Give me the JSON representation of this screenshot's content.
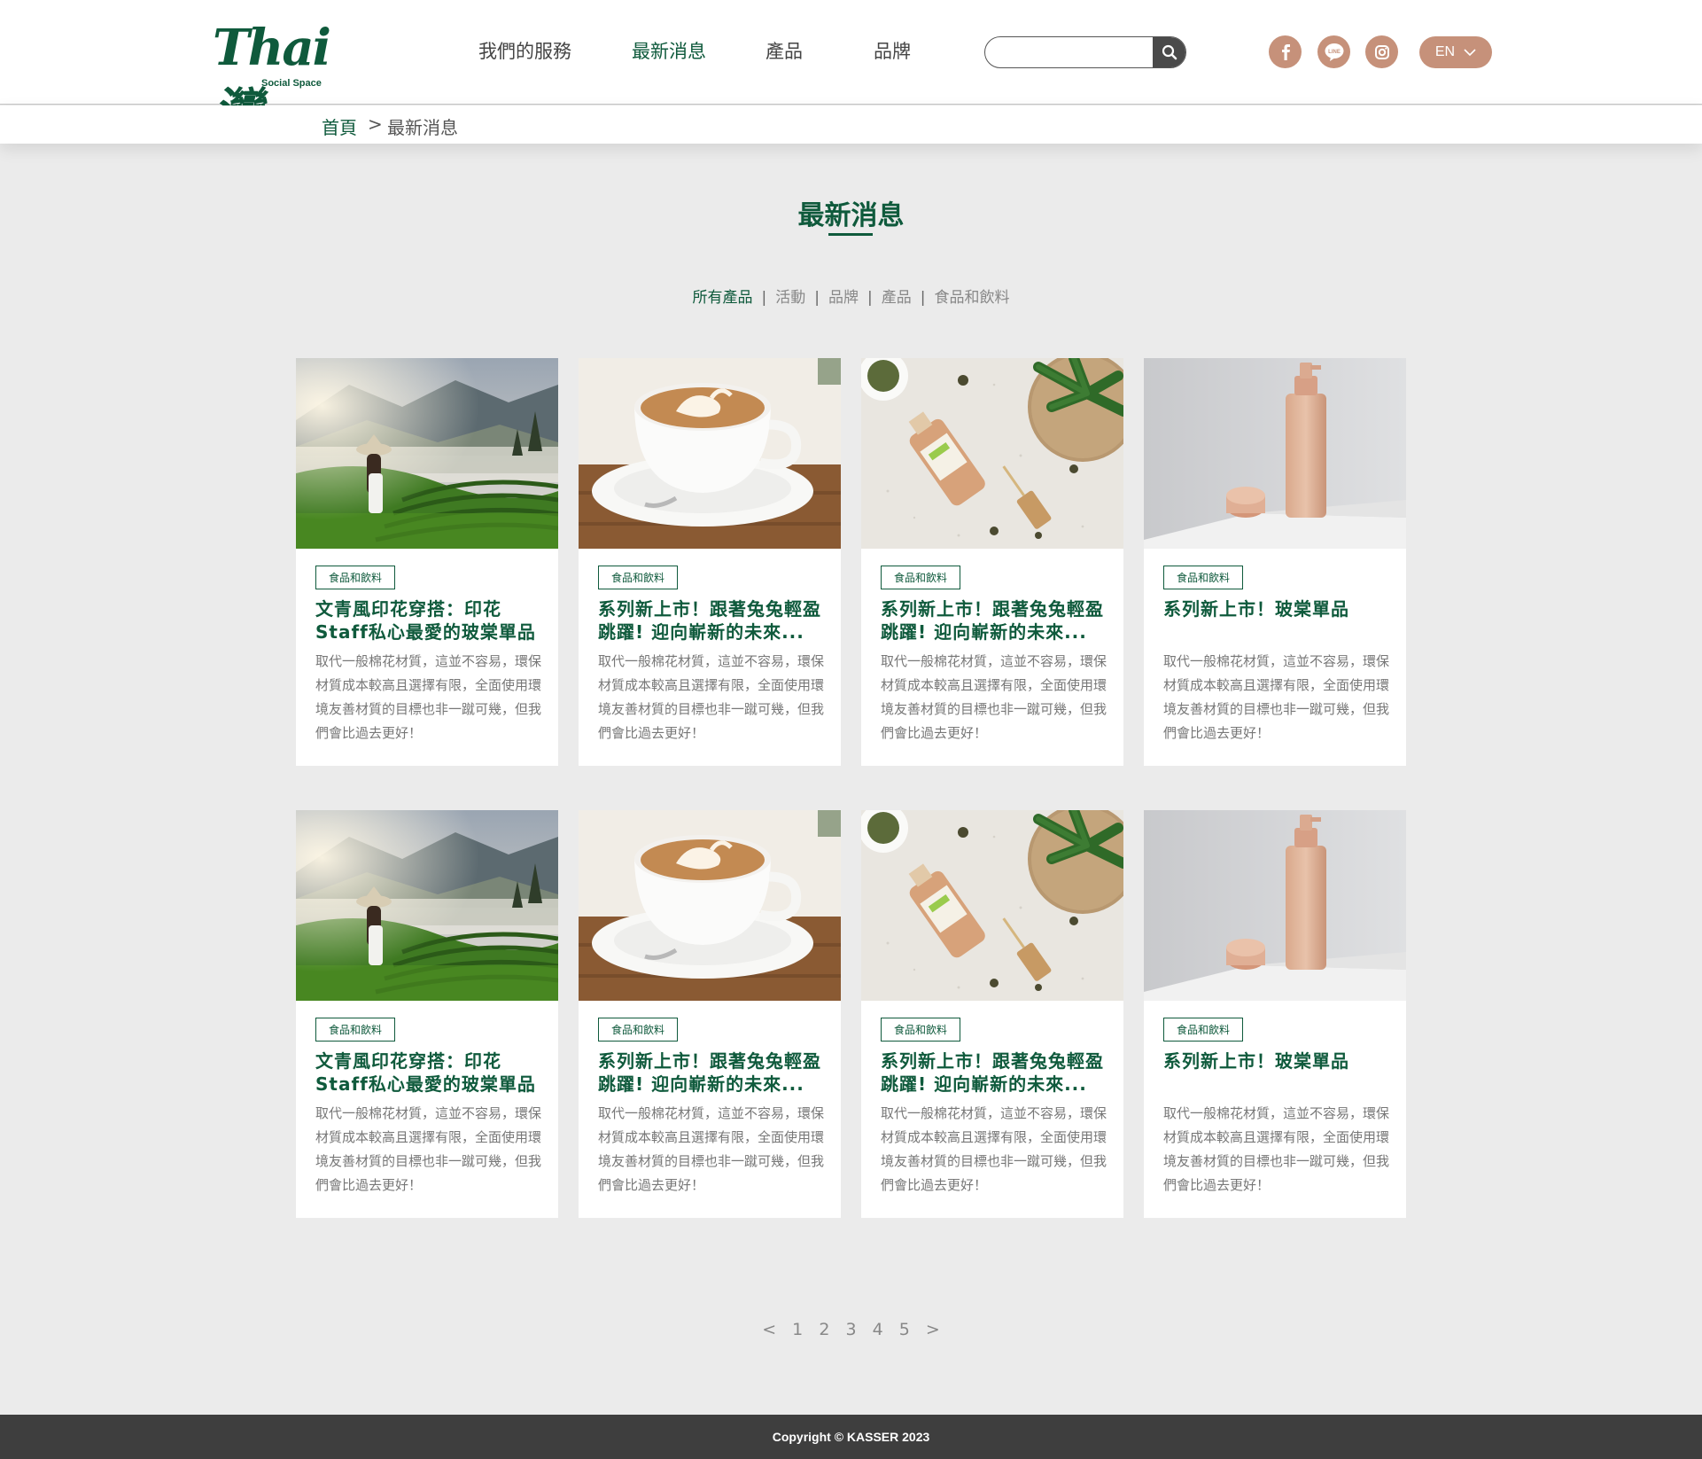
{
  "header": {
    "logo_text": "Thai灣",
    "logo_sub": "Social Space",
    "nav": [
      {
        "label": "我們的服務"
      },
      {
        "label": "最新消息"
      },
      {
        "label": "產品"
      },
      {
        "label": "品牌"
      }
    ],
    "active_nav": "最新消息",
    "search": {
      "placeholder": "",
      "value": ""
    },
    "social": [
      "facebook-icon",
      "line-icon",
      "instagram-icon"
    ],
    "lang": "EN"
  },
  "breadcrumb": {
    "home": "首頁",
    "separator": ">",
    "current": "最新消息"
  },
  "page_title": "最新消息",
  "filters": [
    "所有產品",
    "活動",
    "品牌",
    "產品",
    "食品和飲料"
  ],
  "active_filter": "所有產品",
  "cards": [
    {
      "image": "tea-plantation",
      "tag": "食品和飲料",
      "title": "文青風印花穿搭：印花Staff私心最愛的玻棠單品",
      "desc": "取代一般棉花材質，這並不容易，環保材質成本較高且選擇有限，全面使用環境友善材質的目標也非一蹴可幾，但我們會比過去更好！"
    },
    {
      "image": "latte-cup",
      "tag": "食品和飲料",
      "title": "系列新上市！跟著兔兔輕盈跳躍! 迎向嶄新的未來...",
      "desc": "取代一般棉花材質，這並不容易，環保材質成本較高且選擇有限，全面使用環境友善材質的目標也非一蹴可幾，但我們會比過去更好！"
    },
    {
      "image": "hemp-bottle",
      "tag": "食品和飲料",
      "title": "系列新上市！跟著兔兔輕盈跳躍! 迎向嶄新的未來...",
      "desc": "取代一般棉花材質，這並不容易，環保材質成本較高且選擇有限，全面使用環境友善材質的目標也非一蹴可幾，但我們會比過去更好！"
    },
    {
      "image": "pump-bottle",
      "tag": "食品和飲料",
      "title": "系列新上市！玻棠單品",
      "desc": "取代一般棉花材質，這並不容易，環保材質成本較高且選擇有限，全面使用環境友善材質的目標也非一蹴可幾，但我們會比過去更好！"
    },
    {
      "image": "tea-plantation",
      "tag": "食品和飲料",
      "title": "文青風印花穿搭：印花Staff私心最愛的玻棠單品",
      "desc": "取代一般棉花材質，這並不容易，環保材質成本較高且選擇有限，全面使用環境友善材質的目標也非一蹴可幾，但我們會比過去更好！"
    },
    {
      "image": "latte-cup",
      "tag": "食品和飲料",
      "title": "系列新上市！跟著兔兔輕盈跳躍! 迎向嶄新的未來...",
      "desc": "取代一般棉花材質，這並不容易，環保材質成本較高且選擇有限，全面使用環境友善材質的目標也非一蹴可幾，但我們會比過去更好！"
    },
    {
      "image": "hemp-bottle",
      "tag": "食品和飲料",
      "title": "系列新上市！跟著兔兔輕盈跳躍! 迎向嶄新的未來...",
      "desc": "取代一般棉花材質，這並不容易，環保材質成本較高且選擇有限，全面使用環境友善材質的目標也非一蹴可幾，但我們會比過去更好！"
    },
    {
      "image": "pump-bottle",
      "tag": "食品和飲料",
      "title": "系列新上市！玻棠單品",
      "desc": "取代一般棉花材質，這並不容易，環保材質成本較高且選擇有限，全面使用環境友善材質的目標也非一蹴可幾，但我們會比過去更好！"
    }
  ],
  "pagination": {
    "prev": "<",
    "pages": [
      "1",
      "2",
      "3",
      "4",
      "5"
    ],
    "next": ">"
  },
  "footer": {
    "copyright": "Copyright © KASSER 2023"
  },
  "colors": {
    "brand_green": "#0f5a3c",
    "accent": "#c6917a",
    "background": "#ebebeb",
    "footer": "#3e3e3e"
  }
}
